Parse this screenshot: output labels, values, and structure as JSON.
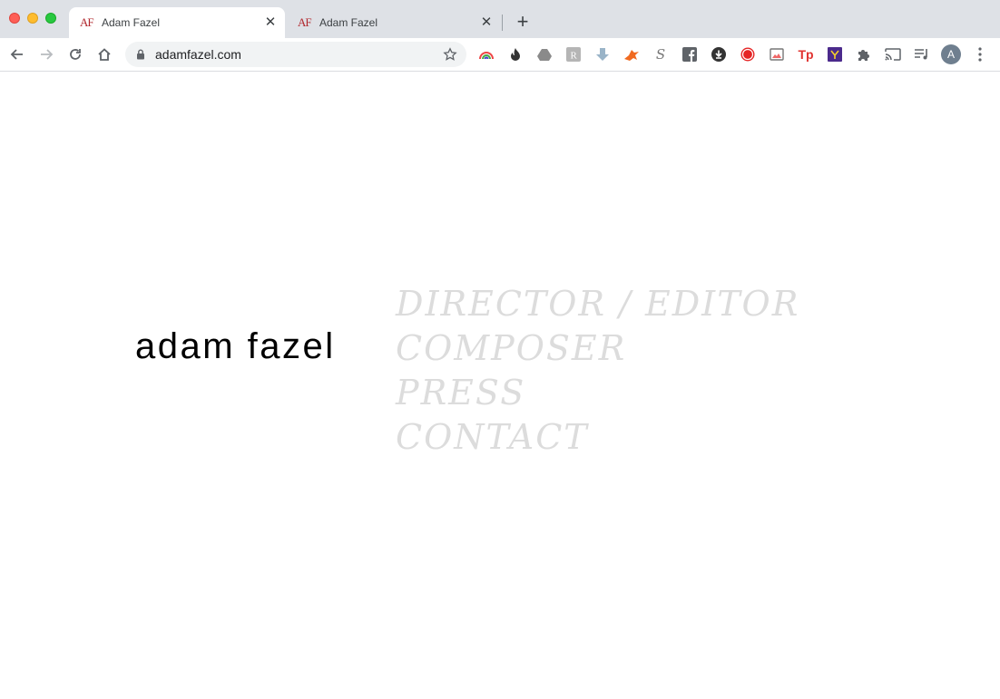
{
  "browser": {
    "tabs": [
      {
        "title": "Adam Fazel",
        "favicon": "AF",
        "active": true
      },
      {
        "title": "Adam Fazel",
        "favicon": "AF",
        "active": false
      }
    ],
    "new_tab_icon": "plus-icon",
    "url": "adamfazel.com",
    "profile_initial": "A",
    "extensions": [
      "rainbow-ext-icon",
      "flame-ext-icon",
      "drive-ext-icon",
      "r-ext-icon",
      "download-arrow-ext-icon",
      "fox-ext-icon",
      "s-ext-icon",
      "facebook-ext-icon",
      "download-circle-ext-icon",
      "record-ext-icon",
      "photo-ext-icon",
      "tp-ext-icon",
      "purple-box-ext-icon",
      "puzzle-icon",
      "cast-icon",
      "media-icon"
    ]
  },
  "page": {
    "logo": "adam fazel",
    "menu": [
      {
        "label": "DIRECTOR / EDITOR"
      },
      {
        "label": "COMPOSER"
      },
      {
        "label": "PRESS"
      },
      {
        "label": "CONTACT"
      }
    ],
    "menu_color": "#dcdcdc",
    "logo_color": "#000000"
  }
}
